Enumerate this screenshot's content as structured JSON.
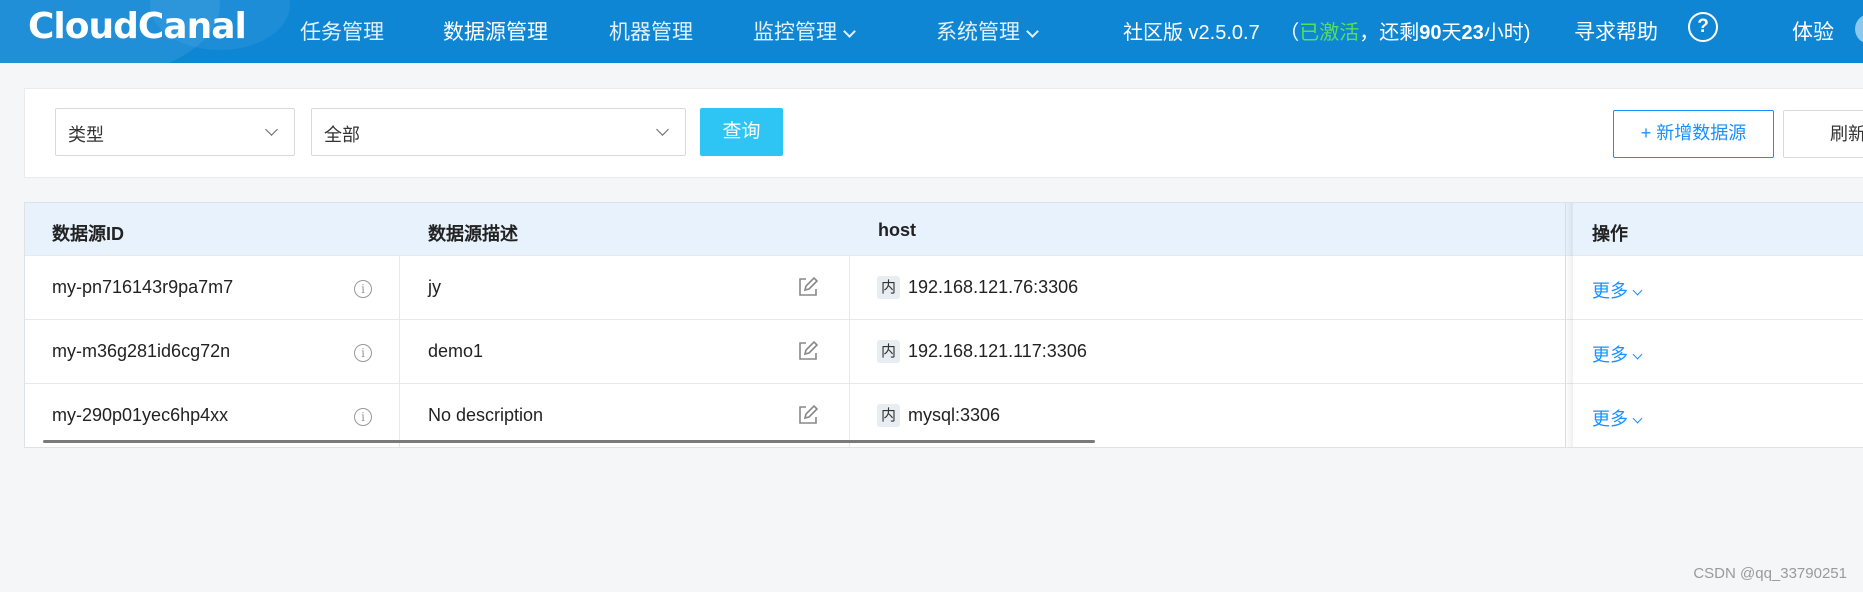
{
  "header": {
    "logo": "CloudCanal",
    "nav": [
      {
        "label": "任务管理",
        "active": false,
        "dropdown": false
      },
      {
        "label": "数据源管理",
        "active": true,
        "dropdown": false
      },
      {
        "label": "机器管理",
        "active": false,
        "dropdown": false
      },
      {
        "label": "监控管理",
        "active": false,
        "dropdown": true
      },
      {
        "label": "系统管理",
        "active": false,
        "dropdown": true
      }
    ],
    "edition": "社区版 v2.5.0.7",
    "paren_open": "（",
    "activated": "已激活",
    "remaining_prefix": "，还剩",
    "days": "90",
    "days_unit": "天",
    "hours": "23",
    "hours_unit": "小时)",
    "help_link": "寻求帮助",
    "help_icon_glyph": "?",
    "trial": "体验",
    "brand_color": "#0e86d4"
  },
  "filter": {
    "type_select": "类型",
    "value_select": "全部",
    "query_button": "查询",
    "add_button": "+ 新增数据源",
    "refresh_button": "刷新"
  },
  "table": {
    "columns": [
      "数据源ID",
      "数据源描述",
      "host",
      "操作"
    ],
    "rows": [
      {
        "id": "my-pn716143r9pa7m7",
        "description": "jy",
        "host_tag": "内",
        "host": "192.168.121.76:3306",
        "action": "更多"
      },
      {
        "id": "my-m36g281id6cg72n",
        "description": "demo1",
        "host_tag": "内",
        "host": "192.168.121.117:3306",
        "action": "更多"
      },
      {
        "id": "my-290p01yec6hp4xx",
        "description": "No description",
        "host_tag": "内",
        "host": "mysql:3306",
        "action": "更多"
      }
    ],
    "info_glyph": "i"
  },
  "watermark": "CSDN @qq_33790251"
}
